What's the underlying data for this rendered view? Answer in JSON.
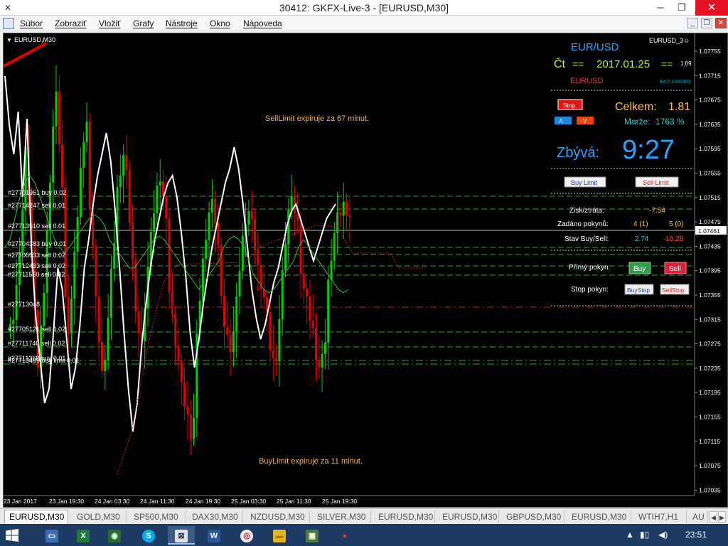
{
  "window": {
    "title": "30412: GKFX-Live-3 - [EURUSD,M30]",
    "minimize": "─",
    "restore": "❐",
    "close": "✕"
  },
  "menu": {
    "items": [
      "Súbor",
      "Zobraziť",
      "Vložiť",
      "Grafy",
      "Nástroje",
      "Okno",
      "Nápoveda"
    ],
    "mdi_minimize": "_",
    "mdi_restore": "❐",
    "mdi_close": "✕"
  },
  "chart": {
    "symbol_label": "EURUSD,M30",
    "ea_label": "EURUSD_3☺",
    "current_price": "1.07461",
    "price_ticks": [
      "1.07755",
      "1.07715",
      "1.07675",
      "1.07635",
      "1.07595",
      "1.07555",
      "1.07515",
      "1.07475",
      "1.07435",
      "1.07395",
      "1.07355",
      "1.07315",
      "1.07275",
      "1.07235",
      "1.07195",
      "1.07155",
      "1.07115",
      "1.07075",
      "1.07035"
    ],
    "time_ticks": [
      "23 Jan 2017",
      "23 Jan 19:30",
      "24 Jan 03:30",
      "24 Jan 11:30",
      "24 Jan 19:30",
      "25 Jan 03:30",
      "25 Jan 11:30",
      "25 Jan 19:30"
    ],
    "msg_sell_limit": "SellLimit expiruje za 67 minut.",
    "msg_buy_limit": "BuyLimit expiruje za 11 minut.",
    "order_labels": [
      "#27701961 buy 0.02",
      "#27714247 sell 0.01",
      "#27713510 sell 0.01",
      "#27704383 buy 0.01",
      "#27708633 sell 0.02",
      "#27712433 sell 0.02",
      "#27711550 sell 0.02",
      "#27713048",
      "#27705121 sell 0.02",
      "#27711740 sell 0.02",
      "#27713489 buy limit 0.01",
      "#27711368 buy 0.01"
    ]
  },
  "panel": {
    "pair": "EUR/USD",
    "day": "Čt",
    "equals": "==",
    "date": "2017.01.25",
    "price_small": "1.09",
    "symbol": "EURUSD",
    "ea_no": "EA č.1300303",
    "stop_button": "Stop",
    "up_button": "/\\",
    "down_button": "V",
    "celkem_label": "Celkem:",
    "celkem_value": "1.81",
    "marze_label": "Marže:",
    "marze_value": "1763 %",
    "zbyva_label": "Zbývá:",
    "countdown": "9:27",
    "buy_limit_button": "Buy Limit",
    "sell_limit_button": "Sell Limit",
    "zisk_label": "Zisk/ztráta:",
    "zisk_value": "-7.54",
    "zadano_label": "Zadáno pokynů:",
    "zadano_buy": "4 (1)",
    "zadano_sell": "5 (0)",
    "stav_label": "Stav Buy/Sell:",
    "stav_buy": "2.74",
    "stav_sell": "-10.28",
    "primy_label": "Přímý pokyn:",
    "buy_button": "Buy",
    "sell_button": "Sell",
    "stop_pokyn_label": "Stop pokyn:",
    "buystop_button": "BuyStop",
    "sellstop_button": "SellStop"
  },
  "colors": {
    "bull": "#00d000",
    "bear": "#e00000",
    "price_line": "#ffffff",
    "grid_dash_green": "#3c9c3c",
    "grid_dash_red": "#b03030",
    "accent_blue": "#29a3ff",
    "panel_gold": "#ffc24a",
    "panel_lime": "#b8f040"
  },
  "tabs": [
    "EURUSD,M30",
    "GOLD,M30",
    "SP500,M30",
    "DAX30,M30",
    "NZDUSD,M30",
    "SILVER,M30",
    "EURUSD,M30",
    "EURUSD,M30",
    "GBPUSD,M30",
    "EURUSD,M30",
    "WTIH7,H1",
    "AU"
  ],
  "taskbar": {
    "apps": [
      {
        "icon": "file-explorer-icon",
        "glyph": "▭"
      },
      {
        "icon": "excel-icon",
        "glyph": "X"
      },
      {
        "icon": "web-icon",
        "glyph": "◉"
      },
      {
        "icon": "skype-icon",
        "glyph": "S"
      },
      {
        "icon": "metatrader-icon",
        "glyph": "⊠"
      },
      {
        "icon": "word-icon",
        "glyph": "W"
      },
      {
        "icon": "chrome-icon",
        "glyph": "◎"
      },
      {
        "icon": "folder-icon",
        "glyph": "▬"
      },
      {
        "icon": "photos-icon",
        "glyph": "▣"
      },
      {
        "icon": "app-dots-icon",
        "glyph": "●"
      }
    ],
    "clock": "23:51"
  }
}
